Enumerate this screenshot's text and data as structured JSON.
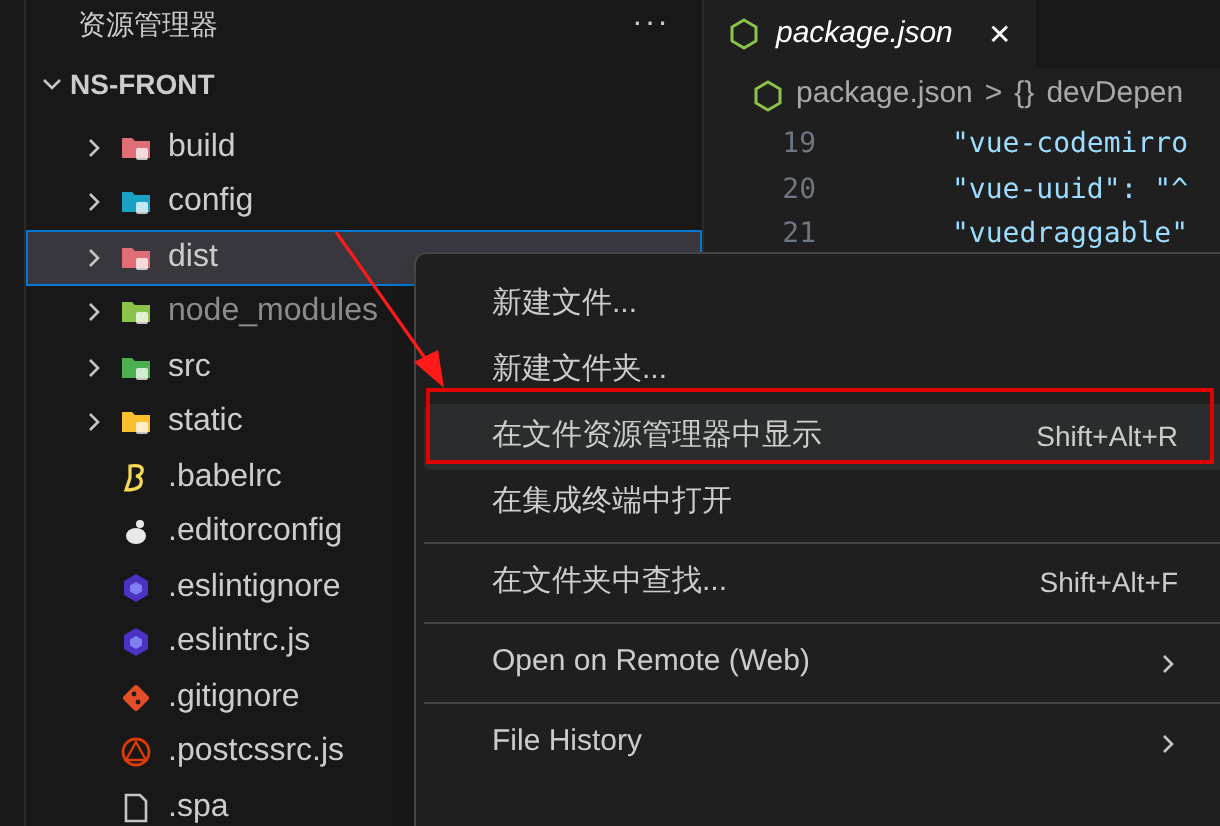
{
  "sidebar": {
    "title": "资源管理器",
    "more": "···",
    "root": {
      "label": "NS-FRONT",
      "expanded": true
    },
    "items": [
      {
        "name": "build",
        "kind": "folder",
        "color": "#e06c75",
        "expanded": false,
        "selected": false,
        "dimmed": false
      },
      {
        "name": "config",
        "kind": "folder",
        "color": "#1ba1c4",
        "expanded": false,
        "selected": false,
        "dimmed": false
      },
      {
        "name": "dist",
        "kind": "folder",
        "color": "#e06c75",
        "expanded": false,
        "selected": true,
        "dimmed": false
      },
      {
        "name": "node_modules",
        "kind": "folder",
        "color": "#8bc34a",
        "expanded": false,
        "selected": false,
        "dimmed": true
      },
      {
        "name": "src",
        "kind": "folder",
        "color": "#4caf50",
        "expanded": false,
        "selected": false,
        "dimmed": false
      },
      {
        "name": "static",
        "kind": "folder",
        "color": "#f9bf2d",
        "expanded": false,
        "selected": false,
        "dimmed": false
      },
      {
        "name": ".babelrc",
        "kind": "babel",
        "color": "#f5da55",
        "selected": false,
        "dimmed": false
      },
      {
        "name": ".editorconfig",
        "kind": "editorconfig",
        "color": "#e8e8e8",
        "selected": false,
        "dimmed": false
      },
      {
        "name": ".eslintignore",
        "kind": "eslint",
        "color": "#4b32c3",
        "selected": false,
        "dimmed": false
      },
      {
        "name": ".eslintrc.js",
        "kind": "eslint",
        "color": "#4b32c3",
        "selected": false,
        "dimmed": false
      },
      {
        "name": ".gitignore",
        "kind": "git",
        "color": "#e44d26",
        "selected": false,
        "dimmed": false
      },
      {
        "name": ".postcssrc.js",
        "kind": "postcss",
        "color": "#dd3a0a",
        "selected": false,
        "dimmed": false
      },
      {
        "name": ".spa",
        "kind": "file",
        "color": "#c5c5c5",
        "selected": false,
        "dimmed": false
      }
    ]
  },
  "editor": {
    "tabs": [
      {
        "label": "package.json",
        "selected": true,
        "close": "✕"
      }
    ],
    "breadcrumb": {
      "file": "package.json",
      "separator": ">",
      "symbol": "{}",
      "path": "devDepen"
    },
    "lines": [
      {
        "number": "19",
        "text": "\"vue-codemirro"
      },
      {
        "number": "20",
        "text": "\"vue-uuid\": \"^"
      },
      {
        "number": "21",
        "text": "\"vuedraggable\""
      }
    ]
  },
  "context_menu": {
    "groups": [
      [
        {
          "label": "新建文件...",
          "selected": false,
          "submenu": false
        },
        {
          "label": "新建文件夹...",
          "selected": false,
          "submenu": false
        },
        {
          "label": "在文件资源管理器中显示",
          "shortcut": "Shift+Alt+R",
          "selected": true,
          "submenu": false
        },
        {
          "label": "在集成终端中打开",
          "selected": false,
          "submenu": false
        }
      ],
      [
        {
          "label": "在文件夹中查找...",
          "shortcut": "Shift+Alt+F",
          "selected": false,
          "submenu": false
        }
      ],
      [
        {
          "label": "Open on Remote (Web)",
          "selected": false,
          "submenu": true
        }
      ],
      [
        {
          "label": "File History",
          "selected": false,
          "submenu": true
        }
      ]
    ]
  }
}
